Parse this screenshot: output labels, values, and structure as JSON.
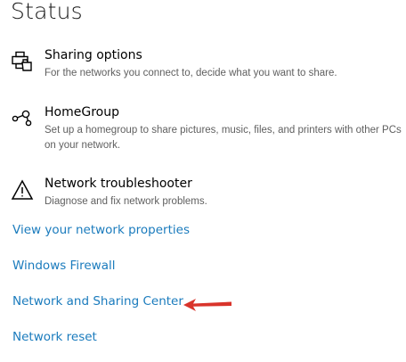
{
  "page": {
    "title": "Status"
  },
  "settings": [
    {
      "title": "Sharing options",
      "description": "For the networks you connect to, decide what you want to share.",
      "icon": "sharing-options-icon"
    },
    {
      "title": "HomeGroup",
      "description": "Set up a homegroup to share pictures, music, files, and printers with other PCs on your network.",
      "icon": "homegroup-icon"
    },
    {
      "title": "Network troubleshooter",
      "description": "Diagnose and fix network problems.",
      "icon": "warning-icon"
    }
  ],
  "links": {
    "network_properties": "View your network properties",
    "windows_firewall": "Windows Firewall",
    "sharing_center": "Network and Sharing Center",
    "network_reset": "Network reset"
  },
  "colors": {
    "link": "#1a7bbd",
    "annotation_arrow": "#d9342b"
  }
}
